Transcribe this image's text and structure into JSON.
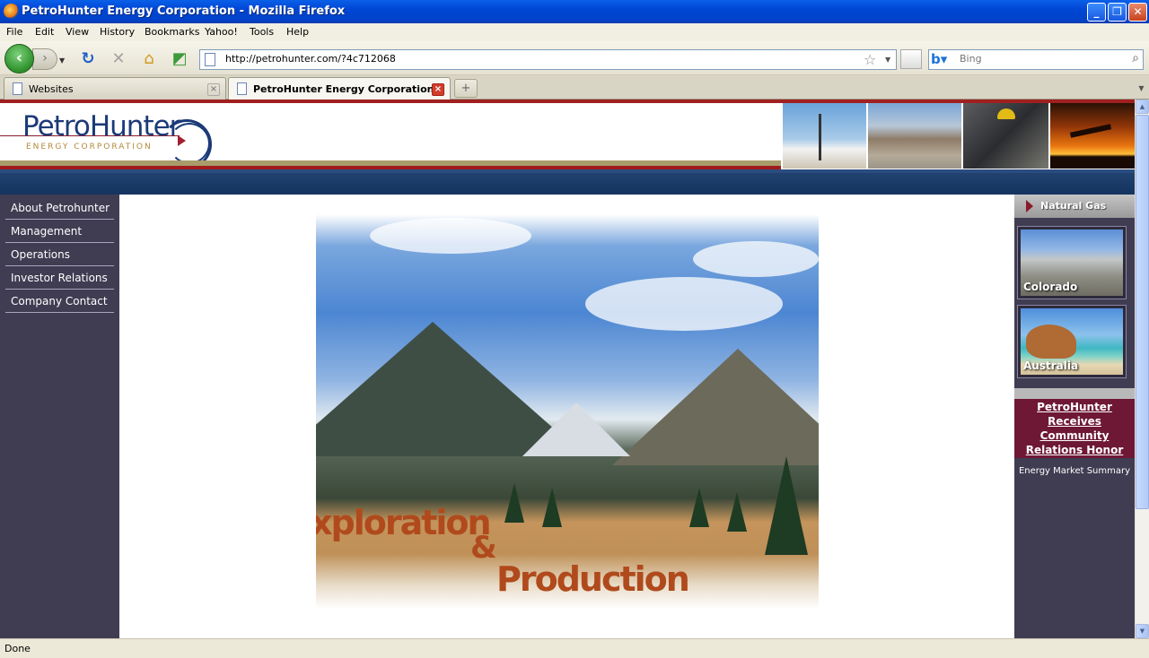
{
  "window": {
    "title": "PetroHunter Energy Corporation - Mozilla Firefox",
    "minimize": "_",
    "restore": "❐",
    "close": "✕"
  },
  "menu": [
    "File",
    "Edit",
    "View",
    "History",
    "Bookmarks",
    "Yahoo!",
    "Tools",
    "Help"
  ],
  "toolbar": {
    "url": "http://petrohunter.com/?4c712068",
    "search_placeholder": "Bing"
  },
  "tabs": [
    {
      "label": "Websites",
      "active": false
    },
    {
      "label": "PetroHunter Energy Corporation",
      "active": true
    }
  ],
  "site": {
    "logo_word": "PetroHunter",
    "logo_tagline": "ENERGY CORPORATION",
    "nav": [
      "About Petrohunter",
      "Management",
      "Operations",
      "Investor Relations",
      "Company Contact"
    ],
    "hero": {
      "line1": "xploration",
      "amp": "&",
      "line2": "Production"
    },
    "right": {
      "section_title": "Natural Gas",
      "cards": [
        "Colorado",
        "Australia"
      ],
      "honor_link": [
        "PetroHunter",
        "Receives",
        "Community",
        "Relations Honor"
      ],
      "market_summary": "Energy Market Summary"
    }
  },
  "status": "Done"
}
